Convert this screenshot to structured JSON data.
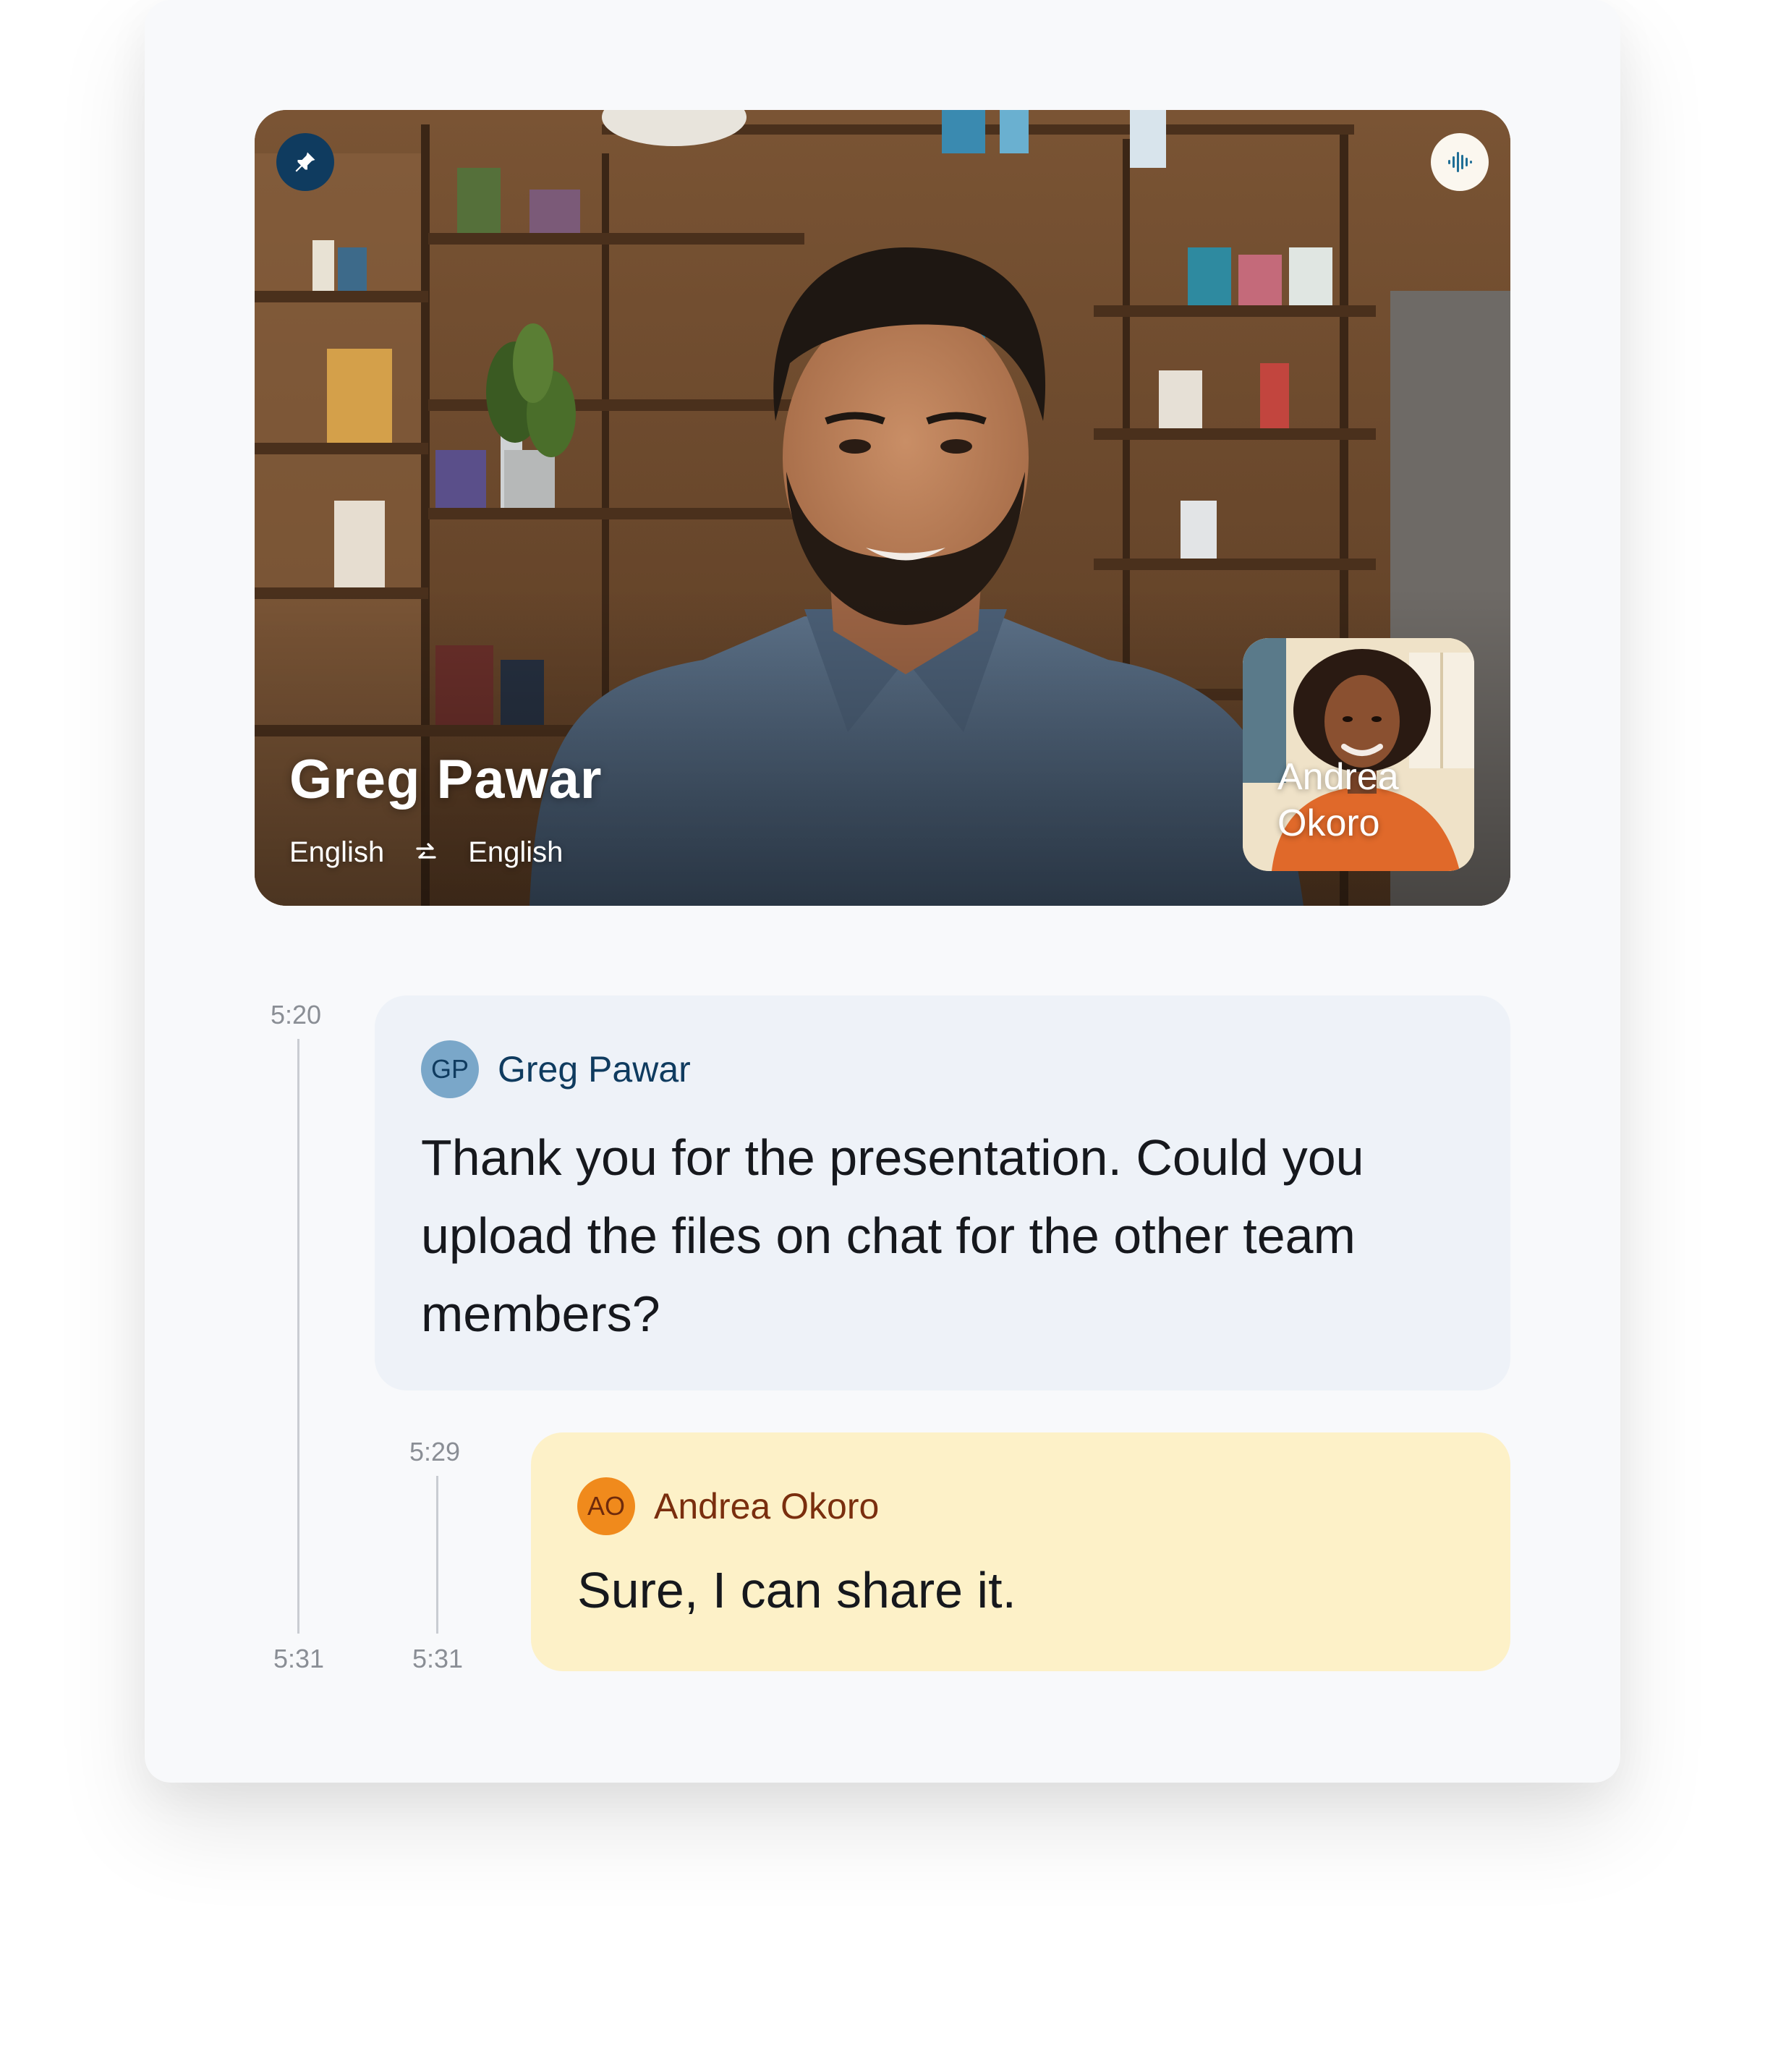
{
  "video": {
    "speaker_name": "Greg Pawar",
    "source_language": "English",
    "target_language": "English",
    "pip_name": "Andrea Okoro",
    "icons": [
      "pin-icon",
      "audio-wave-icon",
      "swap-arrows-icon"
    ]
  },
  "timeline": {
    "outer_start": "5:20",
    "outer_end": "5:31",
    "inner_start": "5:29",
    "inner_end": "5:31"
  },
  "messages": [
    {
      "initials": "GP",
      "sender": "Greg Pawar",
      "text": "Thank you for the presentation. Could you upload the files on chat for the other team members?"
    },
    {
      "initials": "AO",
      "sender": "Andrea Okoro",
      "text": "Sure, I can share it."
    }
  ],
  "colors": {
    "card_bg": "#f8f9fb",
    "greg_bubble": "#eef2f8",
    "andrea_bubble": "#fdf1c8",
    "navy_accent": "#0f3b5f",
    "orange_accent": "#f08a1c"
  }
}
